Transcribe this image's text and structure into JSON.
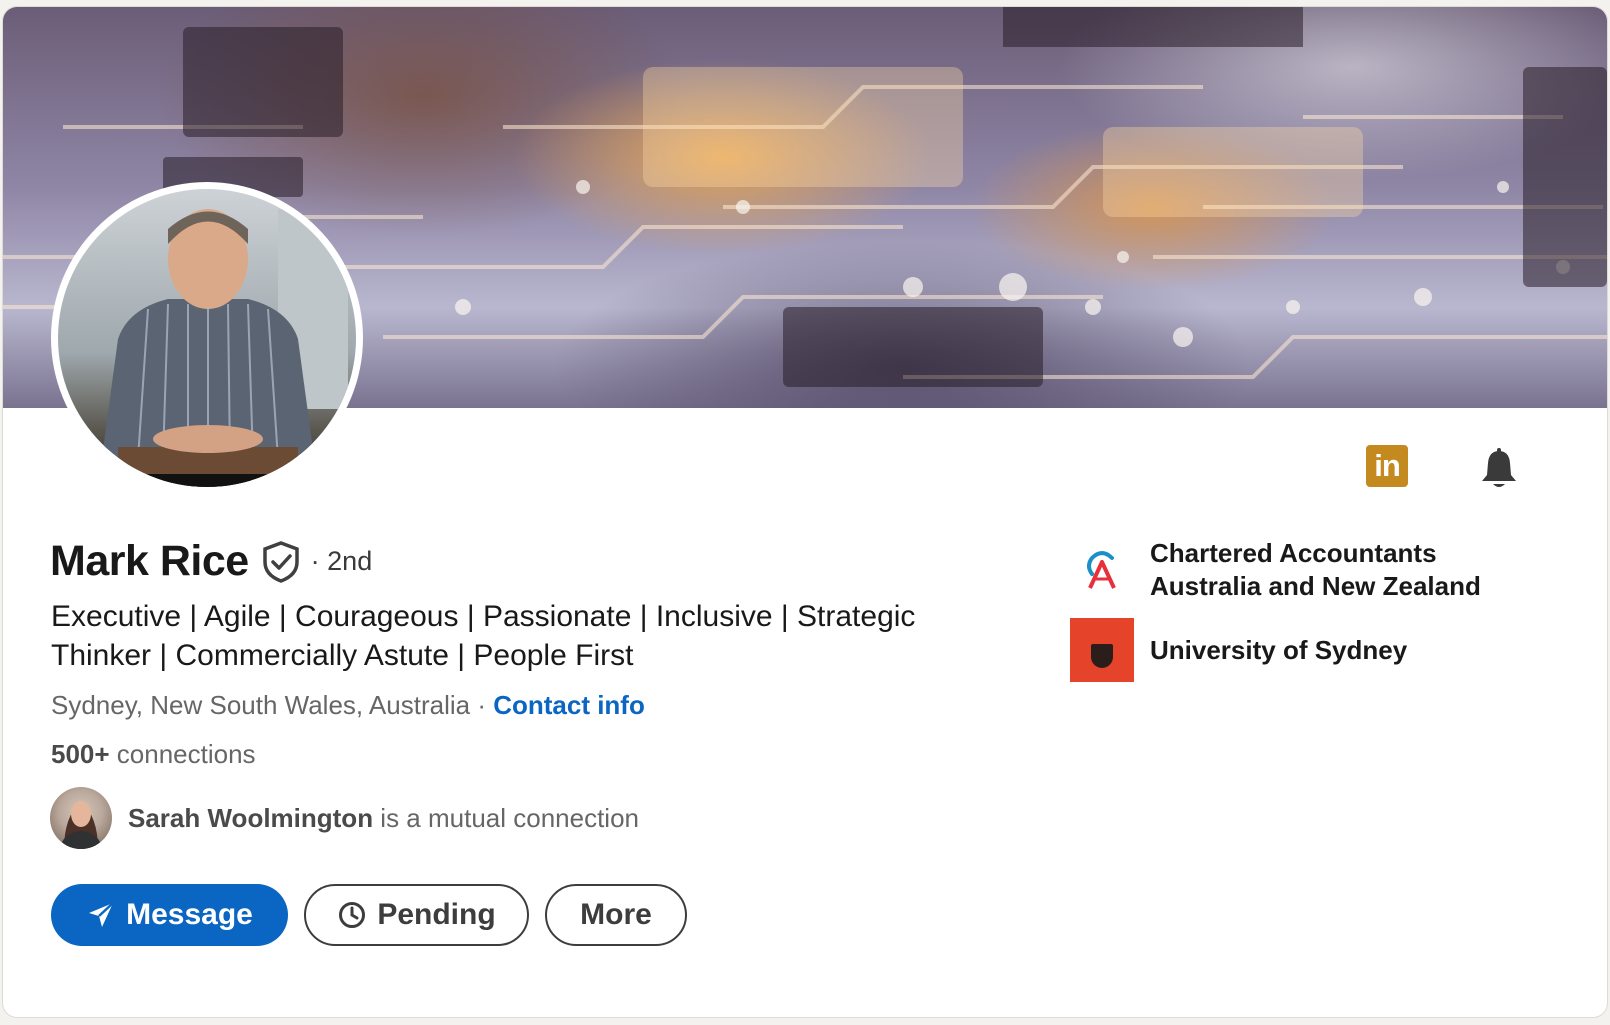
{
  "profile": {
    "name": "Mark Rice",
    "degree": "· 2nd",
    "headline": "Executive | Agile | Courageous | Passionate | Inclusive | Strategic Thinker | Commercially Astute | People First",
    "location": "Sydney, New South Wales, Australia",
    "location_separator": " · ",
    "contact_label": "Contact info",
    "connections_count": "500+",
    "connections_label": " connections"
  },
  "mutual": {
    "name": "Sarah Woolmington",
    "text": " is a mutual connection"
  },
  "actions": {
    "message_label": "Message",
    "pending_label": "Pending",
    "more_label": "More"
  },
  "header_icons": {
    "linkedin": "in",
    "bell": "bell-icon"
  },
  "organizations": [
    {
      "name": "Chartered Accountants Australia and New Zealand",
      "logo": "caanz-logo"
    },
    {
      "name": "University of Sydney",
      "logo": "university-of-sydney-logo"
    }
  ],
  "colors": {
    "primary": "#0a66c2",
    "linkedin_badge": "#c58a1f",
    "uni_red": "#e6442a"
  }
}
